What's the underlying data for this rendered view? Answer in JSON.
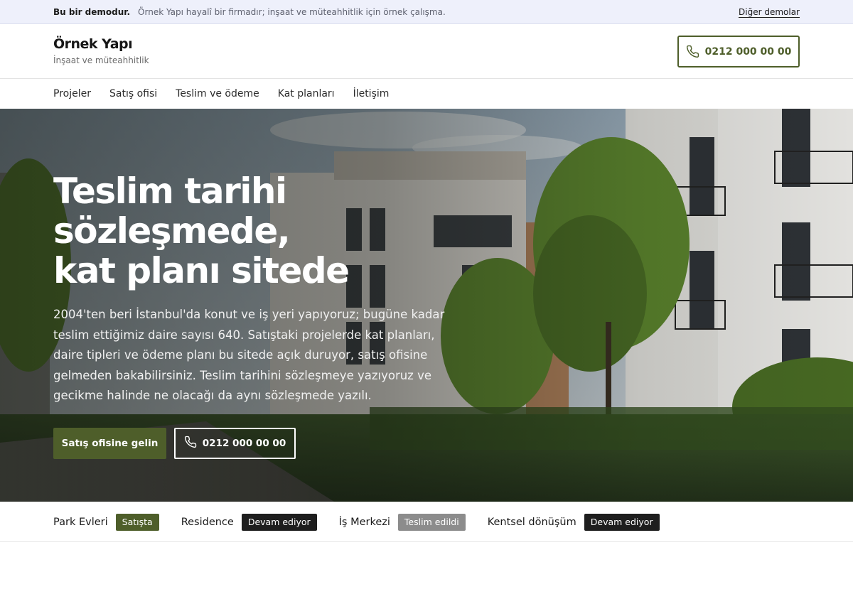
{
  "demo_bar": {
    "strong": "Bu bir demodur.",
    "text": "Örnek Yapı hayalî bir firmadır; inşaat ve müteahhitlik için örnek çalışma.",
    "link": "Diğer demolar"
  },
  "header": {
    "brand_name": "Örnek Yapı",
    "brand_tagline": "İnşaat ve müteahhitlik",
    "phone": "0212 000 00 00",
    "phone_icon": "phone-icon"
  },
  "nav": {
    "items": [
      "Projeler",
      "Satış ofisi",
      "Teslim ve ödeme",
      "Kat planları",
      "İletişim"
    ]
  },
  "hero": {
    "title_lines": [
      "Teslim tarihi",
      "sözleşmede,",
      "kat planı sitede"
    ],
    "lead": "2004'ten beri İstanbul'da konut ve iş yeri yapıyoruz; bugüne kadar teslim ettiğimiz daire sayısı 640. Satıştaki projelerde kat planları, daire tipleri ve ödeme planı bu sitede açık duruyor, satış ofisine gelmeden bakabilirsiniz. Teslim tarihini sözleşmeye yazıyoruz ve gecikme halinde ne olacağı da aynı sözleşmede yazılı.",
    "cta_primary": "Satış ofisine gelin",
    "cta_phone": "0212 000 00 00"
  },
  "projects": [
    {
      "name": "Park Evleri",
      "status": "Satışta"
    },
    {
      "name": "Residence",
      "status": "Devam ediyor"
    },
    {
      "name": "İş Merkezi",
      "status": "Teslim edildi"
    },
    {
      "name": "Kentsel dönüşüm",
      "status": "Devam ediyor"
    }
  ],
  "colors": {
    "accent": "#4e5e2a",
    "demo_bar_bg": "#eef0fb",
    "badge_in_progress": "#1e1e1e",
    "badge_delivered": "#8c8c8c"
  }
}
